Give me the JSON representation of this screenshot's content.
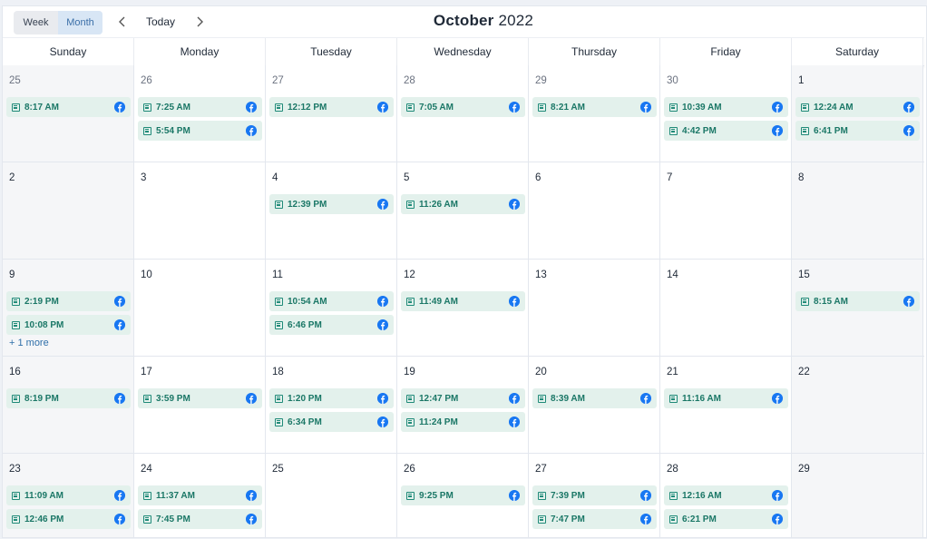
{
  "toolbar": {
    "week_label": "Week",
    "month_label": "Month",
    "prev_icon": "chevron-left-icon",
    "next_icon": "chevron-right-icon",
    "today_label": "Today",
    "title_month": "October",
    "title_year": "2022"
  },
  "colors": {
    "event_bg": "#e3f1ec",
    "event_text": "#1a7766",
    "facebook": "#1877f2",
    "active_view": "#d8e6f5"
  },
  "day_headers": [
    "Sunday",
    "Monday",
    "Tuesday",
    "Wednesday",
    "Thursday",
    "Friday",
    "Saturday"
  ],
  "weeks": [
    [
      {
        "date": "25",
        "other": true,
        "events": [
          "8:17 AM"
        ]
      },
      {
        "date": "26",
        "other": true,
        "events": [
          "7:25 AM",
          "5:54 PM"
        ]
      },
      {
        "date": "27",
        "other": true,
        "events": [
          "12:12 PM"
        ]
      },
      {
        "date": "28",
        "other": true,
        "events": [
          "7:05 AM"
        ]
      },
      {
        "date": "29",
        "other": true,
        "events": [
          "8:21 AM"
        ]
      },
      {
        "date": "30",
        "other": true,
        "events": [
          "10:39 AM",
          "4:42 PM"
        ]
      },
      {
        "date": "1",
        "events": [
          "12:24 AM",
          "6:41 PM"
        ]
      }
    ],
    [
      {
        "date": "2",
        "events": []
      },
      {
        "date": "3",
        "events": []
      },
      {
        "date": "4",
        "events": [
          "12:39 PM"
        ]
      },
      {
        "date": "5",
        "events": [
          "11:26 AM"
        ]
      },
      {
        "date": "6",
        "events": []
      },
      {
        "date": "7",
        "events": []
      },
      {
        "date": "8",
        "events": []
      }
    ],
    [
      {
        "date": "9",
        "events": [
          "2:19 PM",
          "10:08 PM"
        ],
        "more": "+ 1 more"
      },
      {
        "date": "10",
        "events": []
      },
      {
        "date": "11",
        "events": [
          "10:54 AM",
          "6:46 PM"
        ]
      },
      {
        "date": "12",
        "events": [
          "11:49 AM"
        ]
      },
      {
        "date": "13",
        "events": []
      },
      {
        "date": "14",
        "events": []
      },
      {
        "date": "15",
        "events": [
          "8:15 AM"
        ]
      }
    ],
    [
      {
        "date": "16",
        "events": [
          "8:19 PM"
        ]
      },
      {
        "date": "17",
        "events": [
          "3:59 PM"
        ]
      },
      {
        "date": "18",
        "events": [
          "1:20 PM",
          "6:34 PM"
        ]
      },
      {
        "date": "19",
        "events": [
          "12:47 PM",
          "11:24 PM"
        ]
      },
      {
        "date": "20",
        "events": [
          "8:39 AM"
        ]
      },
      {
        "date": "21",
        "events": [
          "11:16 AM"
        ]
      },
      {
        "date": "22",
        "events": []
      }
    ],
    [
      {
        "date": "23",
        "events": [
          "11:09 AM",
          "12:46 PM"
        ]
      },
      {
        "date": "24",
        "events": [
          "11:37 AM",
          "7:45 PM"
        ]
      },
      {
        "date": "25",
        "events": []
      },
      {
        "date": "26",
        "events": [
          "9:25 PM"
        ]
      },
      {
        "date": "27",
        "events": [
          "7:39 PM",
          "7:47 PM"
        ]
      },
      {
        "date": "28",
        "events": [
          "12:16 AM",
          "6:21 PM"
        ]
      },
      {
        "date": "29",
        "events": []
      }
    ]
  ]
}
